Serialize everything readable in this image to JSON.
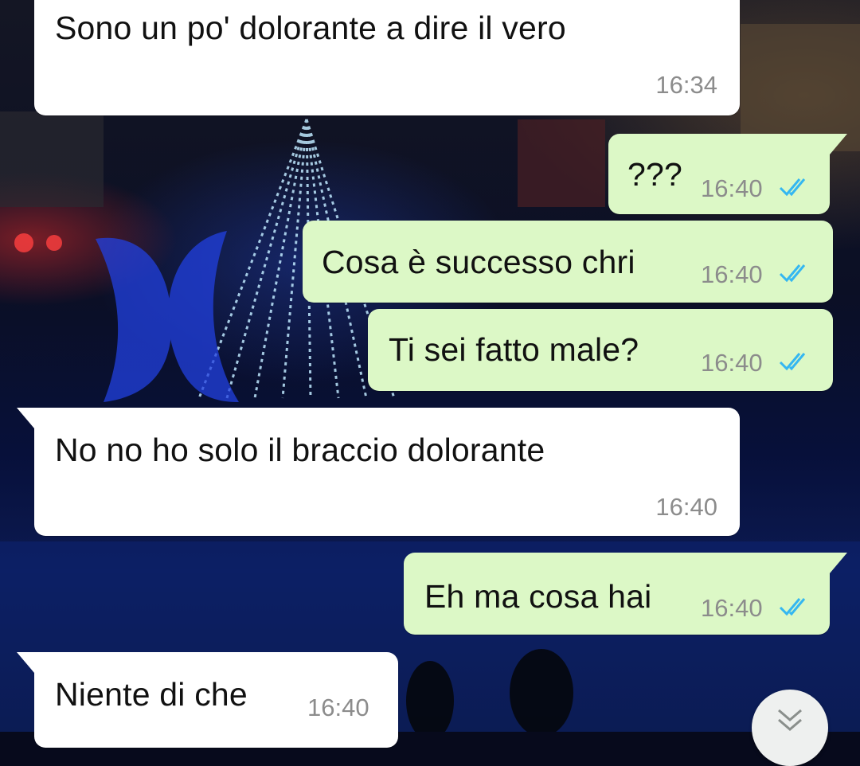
{
  "conversation": {
    "messages": [
      {
        "direction": "incoming",
        "text": "Sono un po' dolorante a dire il vero",
        "time": "16:34"
      },
      {
        "direction": "outgoing",
        "text": "???",
        "time": "16:40",
        "status": "read"
      },
      {
        "direction": "outgoing",
        "text": "Cosa è successo chri",
        "time": "16:40",
        "status": "read"
      },
      {
        "direction": "outgoing",
        "text": "Ti sei fatto male?",
        "time": "16:40",
        "status": "read"
      },
      {
        "direction": "incoming",
        "text": "No no ho solo il braccio dolorante",
        "time": "16:40"
      },
      {
        "direction": "outgoing",
        "text": "Eh ma cosa hai",
        "time": "16:40",
        "status": "read"
      },
      {
        "direction": "incoming",
        "text": "Niente di che",
        "time": "16:40"
      }
    ]
  },
  "colors": {
    "incoming_bubble": "#ffffff",
    "outgoing_bubble": "#dcf8c6",
    "read_ticks": "#34b7f1",
    "timestamp": "#8c8c8c"
  },
  "icons": {
    "read_receipt": "double-check-icon",
    "scroll_down": "chevron-double-down-icon"
  }
}
